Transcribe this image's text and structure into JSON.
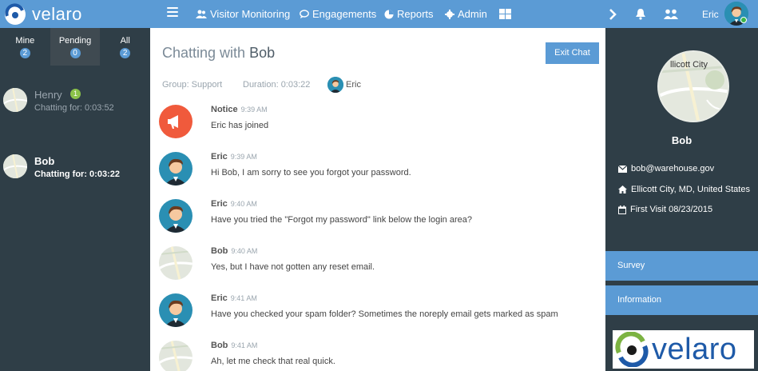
{
  "brand": {
    "name": "velaro",
    "logo_icon": "velaro-swirl-icon"
  },
  "nav": {
    "items": [
      {
        "label": "Visitor Monitoring",
        "icon": "users-icon"
      },
      {
        "label": "Engagements",
        "icon": "speech-bubble-icon"
      },
      {
        "label": "Reports",
        "icon": "pie-chart-icon"
      },
      {
        "label": "Admin",
        "icon": "gear-icon"
      }
    ],
    "username": "Eric"
  },
  "filters": [
    {
      "label": "Mine",
      "count": "2"
    },
    {
      "label": "Pending",
      "count": "0"
    },
    {
      "label": "All",
      "count": "2"
    }
  ],
  "chats": [
    {
      "name": "Henry",
      "badge": "1",
      "time": "Chatting for: 0:03:52"
    },
    {
      "name": "Bob",
      "time": "Chatting for: 0:03:22"
    }
  ],
  "chat": {
    "title_prefix": "Chatting with",
    "title_name": "Bob",
    "exit_label": "Exit Chat",
    "group": "Group: Support",
    "duration": "Duration: 0:03:22",
    "agent": "Eric"
  },
  "messages": [
    {
      "sender": "Notice",
      "time": "9:39 AM",
      "text": "Eric has joined",
      "avatar": "megaphone-icon"
    },
    {
      "sender": "Eric",
      "time": "9:39 AM",
      "text": "Hi Bob, I am sorry to see you forgot your password.",
      "avatar": "agent-avatar"
    },
    {
      "sender": "Eric",
      "time": "9:40 AM",
      "text": "Have you tried the \"Forgot my password\" link below the login area?",
      "avatar": "agent-avatar"
    },
    {
      "sender": "Bob",
      "time": "9:40 AM",
      "text": "Yes, but I have not gotten any reset email.",
      "avatar": "map-avatar"
    },
    {
      "sender": "Eric",
      "time": "9:41 AM",
      "text": "Have you checked your spam folder? Sometimes the noreply email gets marked as spam",
      "avatar": "agent-avatar"
    },
    {
      "sender": "Bob",
      "time": "9:41 AM",
      "text": "Ah, let me check that real quick.",
      "avatar": "map-avatar"
    }
  ],
  "visitor": {
    "map_label": "llicott City",
    "name": "Bob",
    "email": "bob@warehouse.gov",
    "location": "Ellicott City, MD, United States",
    "first_visit": "First Visit 08/23/2015"
  },
  "sections": [
    "Survey",
    "Information"
  ],
  "colors": {
    "primary": "#5b9bd5",
    "dark_panel": "#2f3e47",
    "badge_green": "#8bc34a",
    "notice_red": "#f05a3c"
  }
}
